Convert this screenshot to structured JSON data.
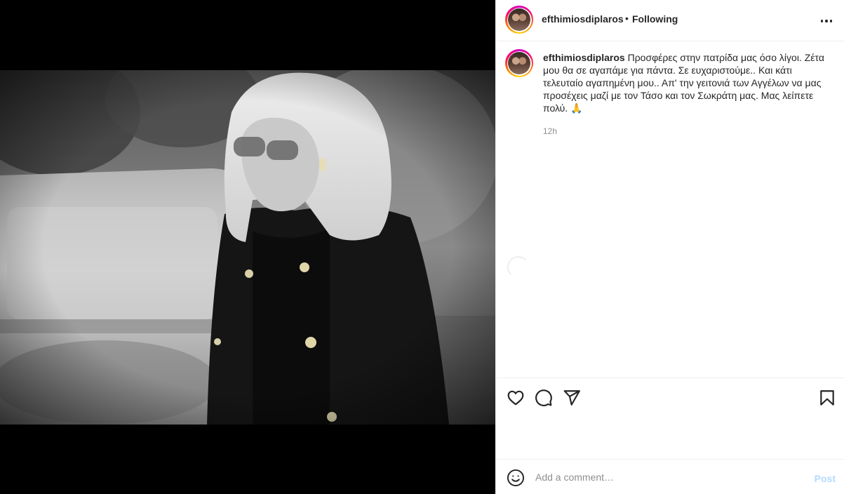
{
  "header": {
    "username": "efthimiosdiplaros",
    "separator": "•",
    "follow_status": "Following",
    "more_icon": "more-horizontal-icon"
  },
  "caption": {
    "username": "efthimiosdiplaros",
    "text": "Προσφέρες στην πατρίδα μας όσο λίγοι. Ζέτα μου θα σε αγαπάμε για πάντα. Σε ευχαριστούμε.. Και κάτι τελευταίο αγαπημένη μου.. Απ' την γειτονιά των Αγγέλων να μας προσέχεις μαζί με τον Τάσο και τον Σωκράτη μας. Μας λείπετε πολύ. 🙏",
    "timestamp": "12h"
  },
  "actions": {
    "like_icon": "heart-icon",
    "comment_icon": "comment-bubble-icon",
    "share_icon": "paper-plane-icon",
    "save_icon": "bookmark-icon"
  },
  "composer": {
    "emoji_icon": "smiley-icon",
    "placeholder": "Add a comment…",
    "value": "",
    "post_label": "Post"
  },
  "colors": {
    "text": "#262626",
    "muted": "#8e8e8e",
    "border": "#efefef",
    "post_button_disabled": "#b3dbff",
    "media_background": "#000000"
  }
}
